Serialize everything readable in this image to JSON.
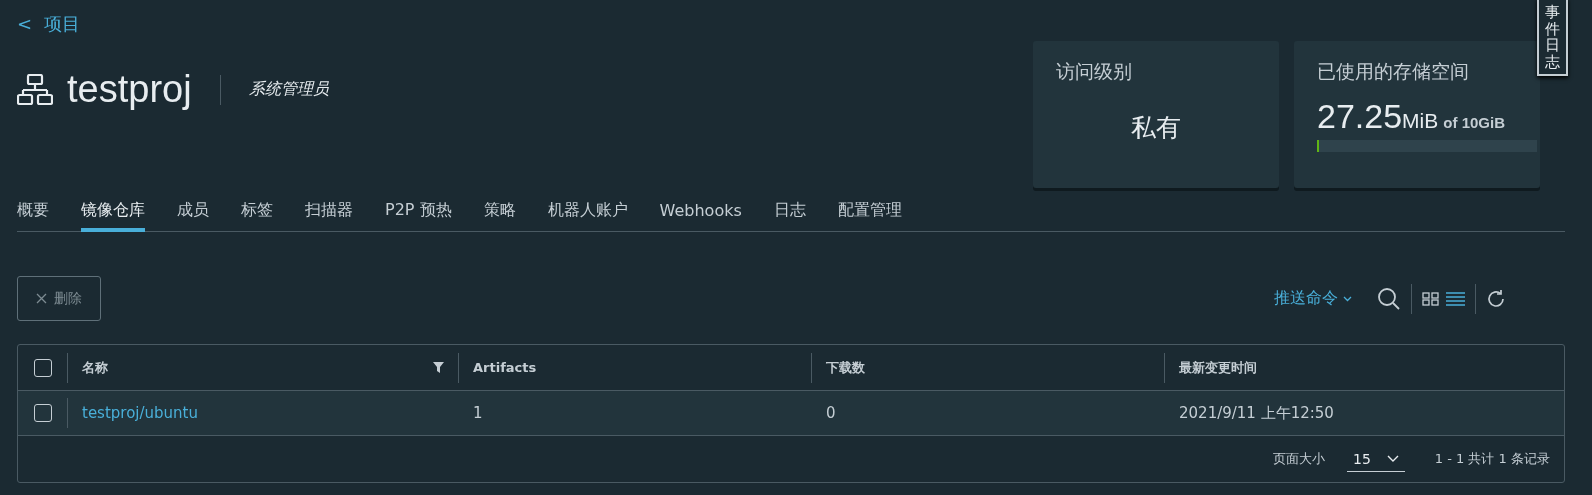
{
  "back_link": {
    "arrow": "<",
    "label": "项目"
  },
  "project": {
    "name": "testproj",
    "role": "系统管理员"
  },
  "cards": [
    {
      "kind": "access",
      "title": "访问级别",
      "value": "私有"
    },
    {
      "kind": "storage",
      "title": "已使用的存储空间",
      "used": "27.25",
      "unit": "MiB",
      "limit": "of 10GiB",
      "level": 0.003
    }
  ],
  "side_tab": {
    "label": "事件日志"
  },
  "tabs": [
    {
      "label": "概要",
      "selected": false
    },
    {
      "label": "镜像仓库",
      "selected": true
    },
    {
      "label": "成员",
      "selected": false
    },
    {
      "label": "标签",
      "selected": false
    },
    {
      "label": "扫描器",
      "selected": false
    },
    {
      "label": "P2P 预热",
      "selected": false
    },
    {
      "label": "策略",
      "selected": false
    },
    {
      "label": "机器人账户",
      "selected": false
    },
    {
      "label": "Webhooks",
      "selected": false
    },
    {
      "label": "日志",
      "selected": false
    },
    {
      "label": "配置管理",
      "selected": false
    }
  ],
  "toolbar": {
    "delete_button": {
      "label": "删除",
      "disabled": true
    },
    "push_command": "推送命令"
  },
  "table": {
    "select_all": {
      "checked": false
    },
    "columns": [
      "名称",
      "Artifacts",
      "下载数",
      "最新变更时间"
    ],
    "rows": [
      {
        "selected": false,
        "cells": [
          "testproj/ubuntu",
          "1",
          "0",
          "2021/9/11 上午12:50"
        ]
      }
    ]
  },
  "footer": {
    "page_size_label": "页面大小",
    "page_size": "15",
    "summary": "1 - 1 共计 1 条记录"
  }
}
